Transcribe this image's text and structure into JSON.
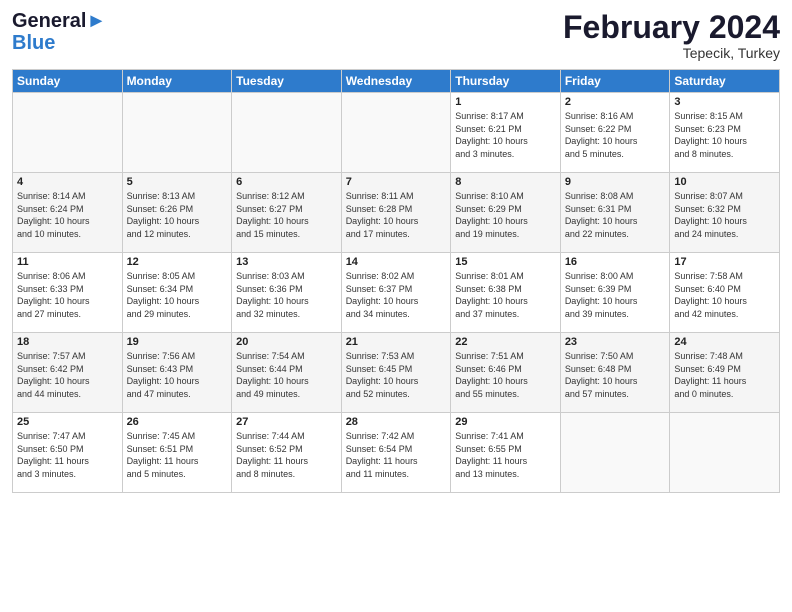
{
  "header": {
    "logo_line1": "General",
    "logo_line2": "Blue",
    "title": "February 2024",
    "subtitle": "Tepecik, Turkey"
  },
  "days_of_week": [
    "Sunday",
    "Monday",
    "Tuesday",
    "Wednesday",
    "Thursday",
    "Friday",
    "Saturday"
  ],
  "weeks": [
    [
      {
        "num": "",
        "detail": ""
      },
      {
        "num": "",
        "detail": ""
      },
      {
        "num": "",
        "detail": ""
      },
      {
        "num": "",
        "detail": ""
      },
      {
        "num": "1",
        "detail": "Sunrise: 8:17 AM\nSunset: 6:21 PM\nDaylight: 10 hours\nand 3 minutes."
      },
      {
        "num": "2",
        "detail": "Sunrise: 8:16 AM\nSunset: 6:22 PM\nDaylight: 10 hours\nand 5 minutes."
      },
      {
        "num": "3",
        "detail": "Sunrise: 8:15 AM\nSunset: 6:23 PM\nDaylight: 10 hours\nand 8 minutes."
      }
    ],
    [
      {
        "num": "4",
        "detail": "Sunrise: 8:14 AM\nSunset: 6:24 PM\nDaylight: 10 hours\nand 10 minutes."
      },
      {
        "num": "5",
        "detail": "Sunrise: 8:13 AM\nSunset: 6:26 PM\nDaylight: 10 hours\nand 12 minutes."
      },
      {
        "num": "6",
        "detail": "Sunrise: 8:12 AM\nSunset: 6:27 PM\nDaylight: 10 hours\nand 15 minutes."
      },
      {
        "num": "7",
        "detail": "Sunrise: 8:11 AM\nSunset: 6:28 PM\nDaylight: 10 hours\nand 17 minutes."
      },
      {
        "num": "8",
        "detail": "Sunrise: 8:10 AM\nSunset: 6:29 PM\nDaylight: 10 hours\nand 19 minutes."
      },
      {
        "num": "9",
        "detail": "Sunrise: 8:08 AM\nSunset: 6:31 PM\nDaylight: 10 hours\nand 22 minutes."
      },
      {
        "num": "10",
        "detail": "Sunrise: 8:07 AM\nSunset: 6:32 PM\nDaylight: 10 hours\nand 24 minutes."
      }
    ],
    [
      {
        "num": "11",
        "detail": "Sunrise: 8:06 AM\nSunset: 6:33 PM\nDaylight: 10 hours\nand 27 minutes."
      },
      {
        "num": "12",
        "detail": "Sunrise: 8:05 AM\nSunset: 6:34 PM\nDaylight: 10 hours\nand 29 minutes."
      },
      {
        "num": "13",
        "detail": "Sunrise: 8:03 AM\nSunset: 6:36 PM\nDaylight: 10 hours\nand 32 minutes."
      },
      {
        "num": "14",
        "detail": "Sunrise: 8:02 AM\nSunset: 6:37 PM\nDaylight: 10 hours\nand 34 minutes."
      },
      {
        "num": "15",
        "detail": "Sunrise: 8:01 AM\nSunset: 6:38 PM\nDaylight: 10 hours\nand 37 minutes."
      },
      {
        "num": "16",
        "detail": "Sunrise: 8:00 AM\nSunset: 6:39 PM\nDaylight: 10 hours\nand 39 minutes."
      },
      {
        "num": "17",
        "detail": "Sunrise: 7:58 AM\nSunset: 6:40 PM\nDaylight: 10 hours\nand 42 minutes."
      }
    ],
    [
      {
        "num": "18",
        "detail": "Sunrise: 7:57 AM\nSunset: 6:42 PM\nDaylight: 10 hours\nand 44 minutes."
      },
      {
        "num": "19",
        "detail": "Sunrise: 7:56 AM\nSunset: 6:43 PM\nDaylight: 10 hours\nand 47 minutes."
      },
      {
        "num": "20",
        "detail": "Sunrise: 7:54 AM\nSunset: 6:44 PM\nDaylight: 10 hours\nand 49 minutes."
      },
      {
        "num": "21",
        "detail": "Sunrise: 7:53 AM\nSunset: 6:45 PM\nDaylight: 10 hours\nand 52 minutes."
      },
      {
        "num": "22",
        "detail": "Sunrise: 7:51 AM\nSunset: 6:46 PM\nDaylight: 10 hours\nand 55 minutes."
      },
      {
        "num": "23",
        "detail": "Sunrise: 7:50 AM\nSunset: 6:48 PM\nDaylight: 10 hours\nand 57 minutes."
      },
      {
        "num": "24",
        "detail": "Sunrise: 7:48 AM\nSunset: 6:49 PM\nDaylight: 11 hours\nand 0 minutes."
      }
    ],
    [
      {
        "num": "25",
        "detail": "Sunrise: 7:47 AM\nSunset: 6:50 PM\nDaylight: 11 hours\nand 3 minutes."
      },
      {
        "num": "26",
        "detail": "Sunrise: 7:45 AM\nSunset: 6:51 PM\nDaylight: 11 hours\nand 5 minutes."
      },
      {
        "num": "27",
        "detail": "Sunrise: 7:44 AM\nSunset: 6:52 PM\nDaylight: 11 hours\nand 8 minutes."
      },
      {
        "num": "28",
        "detail": "Sunrise: 7:42 AM\nSunset: 6:54 PM\nDaylight: 11 hours\nand 11 minutes."
      },
      {
        "num": "29",
        "detail": "Sunrise: 7:41 AM\nSunset: 6:55 PM\nDaylight: 11 hours\nand 13 minutes."
      },
      {
        "num": "",
        "detail": ""
      },
      {
        "num": "",
        "detail": ""
      }
    ]
  ]
}
